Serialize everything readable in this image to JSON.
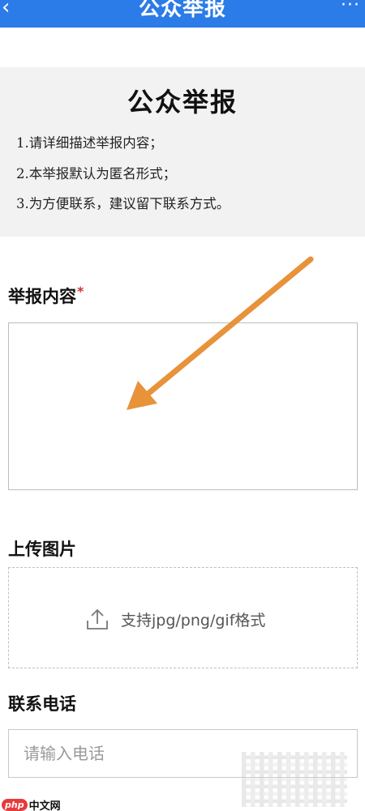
{
  "header": {
    "back_icon": "chevron-left-icon",
    "title": "公众举报",
    "more_label": "···",
    "colors": {
      "bar": "#2b7be8",
      "text": "#ffffff"
    }
  },
  "notice": {
    "title": "公众举报",
    "lines": [
      "1.请详细描述举报内容；",
      "2.本举报默认为匿名形式；",
      "3.为方便联系，建议留下联系方式。"
    ]
  },
  "form": {
    "content": {
      "label": "举报内容",
      "required_mark": "*",
      "value": ""
    },
    "upload": {
      "label": "上传图片",
      "icon": "upload-icon",
      "hint": "支持jpg/png/gif格式"
    },
    "phone": {
      "label": "联系电话",
      "placeholder": "请输入电话",
      "value": ""
    }
  },
  "annotation": {
    "icon": "arrow-annotation",
    "color": "#e8923a"
  },
  "watermark": {
    "badge": "php",
    "text": "中文网"
  }
}
